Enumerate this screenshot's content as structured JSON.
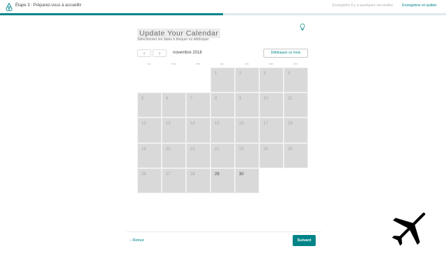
{
  "header": {
    "step_title": "Étape 3 : Préparez-vous à accueillir",
    "saved_text": "Enregistré il y a quelques secondes ·",
    "save_exit_label": "Enregistrer et quitter",
    "progress_fraction": 0.5
  },
  "calendar": {
    "title": "Update Your Calendar",
    "subtitle": "Sélectionnez les dates à bloquer ou débloquer.",
    "month_label": "novembre 2018",
    "prev_glyph": "‹",
    "next_glyph": "›",
    "unblock_label": "Débloquez ce mois",
    "weekdays": [
      "lun.",
      "mar.",
      "mer.",
      "jeu.",
      "ven.",
      "sam.",
      "dim."
    ],
    "leading_blank_days": 3,
    "days": [
      "1",
      "2",
      "3",
      "4",
      "5",
      "6",
      "7",
      "8",
      "9",
      "10",
      "11",
      "12",
      "13",
      "14",
      "15",
      "16",
      "17",
      "18",
      "19",
      "20",
      "21",
      "22",
      "23",
      "24",
      "25",
      "26",
      "27",
      "28",
      "29",
      "30"
    ],
    "dark_days": [
      "29",
      "30"
    ]
  },
  "footer": {
    "back_label": "Retour",
    "next_label": "Suivant"
  },
  "colors": {
    "accent": "#008489",
    "blocked_day": "#d9d9d9",
    "watermark": "#000000"
  },
  "icons": {
    "logo": "airbnb-logo-icon",
    "bulb": "lightbulb-icon",
    "back": "chevron-left-icon",
    "watermark": "airplane-icon"
  }
}
